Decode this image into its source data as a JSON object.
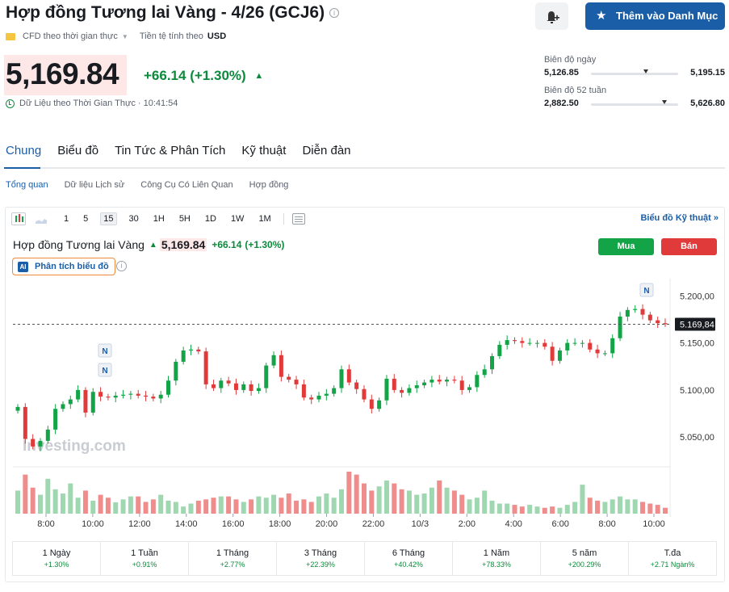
{
  "header": {
    "title": "Hợp đồng Tương lai Vàng - 4/26 (GCJ6)",
    "watchlist_label": "Thêm vào Danh Mục",
    "cfd_label": "CFD theo thời gian thực",
    "currency_label": "Tiền tệ tính theo",
    "currency": "USD"
  },
  "quote": {
    "price": "5,169.84",
    "change": "+66.14",
    "change_pct": "(+1.30%)",
    "realtime_label": "Dữ Liệu theo Thời Gian Thực · 10:41:54"
  },
  "ranges": {
    "day": {
      "label": "Biên độ ngày",
      "low": "5,126.85",
      "high": "5,195.15",
      "position": 0.63
    },
    "week52": {
      "label": "Biên độ 52 tuần",
      "low": "2,882.50",
      "high": "5,626.80",
      "position": 0.84
    }
  },
  "tabs": [
    "Chung",
    "Biểu đồ",
    "Tin Tức & Phân Tích",
    "Kỹ thuật",
    "Diễn đàn"
  ],
  "subtabs": [
    "Tổng quan",
    "Dữ liệu Lịch sử",
    "Công Cụ Có Liên Quan",
    "Hợp đồng"
  ],
  "toolbar": {
    "intervals": [
      "1",
      "5",
      "15",
      "30",
      "1H",
      "5H",
      "1D",
      "1W",
      "1M"
    ],
    "active_interval": "15",
    "tech_link": "Biểu đồ Kỹ thuật »"
  },
  "chart": {
    "title": "Hợp đồng Tương lai Vàng",
    "price": "5,169.84",
    "change": "+66.14",
    "change_pct": "(+1.30%)",
    "buy_label": "Mua",
    "sell_label": "Bán",
    "ai_label": "Phân tích biểu đồ",
    "ai_badge": "AI",
    "watermark": "Investing.com",
    "news_marker": "N",
    "colors": {
      "up": "#13a447",
      "down": "#e03a3a",
      "vol_up": "#9fd8b0",
      "vol_down": "#ef8d8d"
    }
  },
  "chart_data": {
    "type": "candlestick",
    "y_ticks": [
      "5.200,00",
      "5.150,00",
      "5.100,00",
      "5.050,00"
    ],
    "y_tick_values": [
      5200,
      5150,
      5100,
      5050
    ],
    "ylim": [
      5021,
      5214
    ],
    "last_price_label": "5.169,84",
    "last_price": 5169.84,
    "x_ticks": [
      "8:00",
      "10:00",
      "12:00",
      "14:00",
      "16:00",
      "18:00",
      "20:00",
      "22:00",
      "10/3",
      "2:00",
      "4:00",
      "6:00",
      "8:00",
      "10:00"
    ],
    "closes": [
      5082,
      5048,
      5040,
      5046,
      5058,
      5080,
      5085,
      5090,
      5100,
      5076,
      5098,
      5093,
      5092,
      5094,
      5095,
      5096,
      5094,
      5093,
      5091,
      5095,
      5110,
      5130,
      5142,
      5143,
      5141,
      5106,
      5102,
      5110,
      5107,
      5100,
      5106,
      5099,
      5102,
      5126,
      5137,
      5114,
      5111,
      5106,
      5092,
      5090,
      5094,
      5096,
      5102,
      5122,
      5108,
      5101,
      5090,
      5080,
      5089,
      5112,
      5100,
      5097,
      5102,
      5105,
      5108,
      5111,
      5109,
      5111,
      5110,
      5100,
      5103,
      5116,
      5122,
      5136,
      5148,
      5153,
      5152,
      5150,
      5150,
      5150,
      5146,
      5131,
      5142,
      5150,
      5150,
      5150,
      5143,
      5139,
      5139,
      5155,
      5178,
      5185,
      5186,
      5180,
      5174,
      5171,
      5170
    ],
    "opens": [
      5078,
      5082,
      5048,
      5040,
      5046,
      5058,
      5080,
      5085,
      5090,
      5100,
      5076,
      5098,
      5093,
      5092,
      5094,
      5095,
      5096,
      5094,
      5093,
      5091,
      5095,
      5110,
      5130,
      5142,
      5143,
      5141,
      5106,
      5102,
      5110,
      5107,
      5100,
      5106,
      5099,
      5102,
      5126,
      5137,
      5114,
      5111,
      5106,
      5092,
      5090,
      5094,
      5096,
      5102,
      5122,
      5108,
      5101,
      5090,
      5080,
      5089,
      5112,
      5100,
      5097,
      5102,
      5105,
      5108,
      5111,
      5109,
      5111,
      5110,
      5100,
      5103,
      5116,
      5122,
      5136,
      5148,
      5153,
      5152,
      5150,
      5150,
      5150,
      5146,
      5131,
      5142,
      5150,
      5150,
      5150,
      5143,
      5139,
      5139,
      5155,
      5178,
      5185,
      5186,
      5180,
      5174,
      5171
    ],
    "volumes": [
      0.55,
      0.93,
      0.62,
      0.45,
      0.83,
      0.58,
      0.48,
      0.72,
      0.38,
      0.55,
      0.31,
      0.45,
      0.38,
      0.27,
      0.34,
      0.41,
      0.41,
      0.28,
      0.34,
      0.45,
      0.31,
      0.28,
      0.17,
      0.24,
      0.31,
      0.34,
      0.38,
      0.41,
      0.41,
      0.34,
      0.28,
      0.34,
      0.41,
      0.38,
      0.45,
      0.38,
      0.48,
      0.31,
      0.34,
      0.28,
      0.41,
      0.48,
      0.38,
      0.58,
      1.0,
      0.93,
      0.72,
      0.55,
      0.65,
      0.79,
      0.72,
      0.58,
      0.55,
      0.45,
      0.48,
      0.62,
      0.79,
      0.62,
      0.55,
      0.45,
      0.34,
      0.38,
      0.55,
      0.31,
      0.24,
      0.24,
      0.21,
      0.17,
      0.21,
      0.17,
      0.14,
      0.17,
      0.14,
      0.21,
      0.28,
      0.69,
      0.38,
      0.31,
      0.28,
      0.34,
      0.41,
      0.34,
      0.34,
      0.28,
      0.24,
      0.21,
      0.14
    ]
  },
  "periods": [
    {
      "label": "1 Ngày",
      "value": "+1.30%"
    },
    {
      "label": "1 Tuần",
      "value": "+0.91%"
    },
    {
      "label": "1 Tháng",
      "value": "+2.77%"
    },
    {
      "label": "3 Tháng",
      "value": "+22.39%"
    },
    {
      "label": "6 Tháng",
      "value": "+40.42%"
    },
    {
      "label": "1 Năm",
      "value": "+78.33%"
    },
    {
      "label": "5 năm",
      "value": "+200.29%"
    },
    {
      "label": "T.đa",
      "value": "+2.71 Ngàn%"
    }
  ]
}
